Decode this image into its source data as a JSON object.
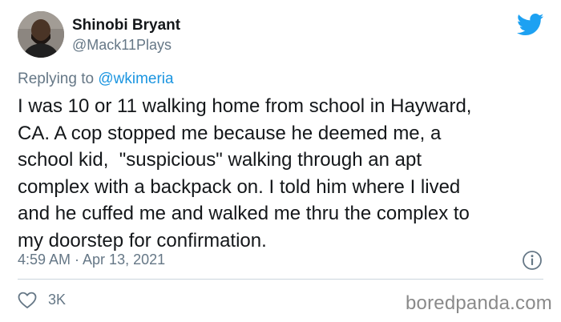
{
  "author": {
    "display_name": "Shinobi Bryant",
    "handle": "@Mack11Plays",
    "avatar_icon": "person-avatar"
  },
  "reply": {
    "prefix": "Replying to ",
    "mention": "@wkimeria"
  },
  "tweet": {
    "text": "I was 10 or 11 walking home from school in Hayward,\nCA. A cop stopped me because he deemed me, a\nschool kid,  \"suspicious\" walking through an apt\ncomplex with a backpack on. I told him where I lived\nand he cuffed me and walked me thru the complex to\nmy doorstep for confirmation.",
    "timestamp": "4:59 AM · Apr 13, 2021",
    "likes": "3K"
  },
  "icons": {
    "brand": "twitter-bird-icon",
    "info": "info-icon",
    "like": "heart-icon"
  },
  "colors": {
    "brand_blue": "#1da1f2",
    "secondary_text": "#657786",
    "link": "#1b95e0",
    "divider": "#ccd6dd"
  },
  "watermark": "boredpanda.com"
}
